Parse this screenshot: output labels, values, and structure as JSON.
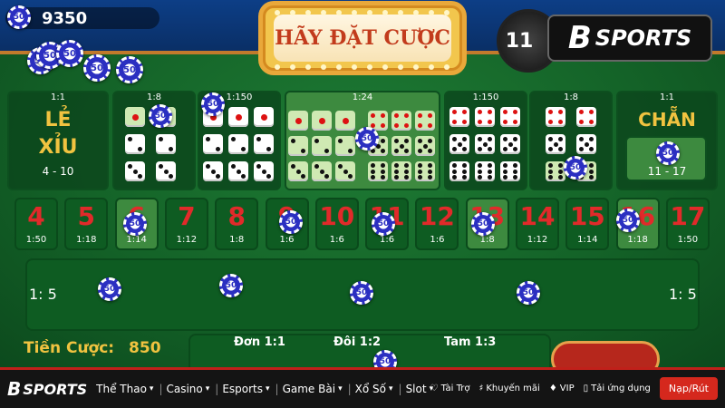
{
  "header": {
    "balance": "9350",
    "banner_text": "HÃY ĐẶT CƯỢC",
    "timer": "11",
    "brand_name": "SPORTS",
    "brand_letter": "B"
  },
  "chip_value": "50",
  "bets": {
    "le": {
      "odds": "1:1",
      "line1": "LẺ",
      "line2": "XỈU",
      "range": "4 - 10"
    },
    "chan": {
      "odds": "1:1",
      "line1": "CHẴN",
      "range": "11 - 17"
    },
    "group_odds": [
      "1:8",
      "1:150",
      "1:24",
      "1:150",
      "1:8"
    ]
  },
  "sums": [
    {
      "n": "4",
      "r": "1:50"
    },
    {
      "n": "5",
      "r": "1:18"
    },
    {
      "n": "6",
      "r": "1:14"
    },
    {
      "n": "7",
      "r": "1:12"
    },
    {
      "n": "8",
      "r": "1:8"
    },
    {
      "n": "9",
      "r": "1:6"
    },
    {
      "n": "10",
      "r": "1:6"
    },
    {
      "n": "11",
      "r": "1:6"
    },
    {
      "n": "12",
      "r": "1:6"
    },
    {
      "n": "13",
      "r": "1:8"
    },
    {
      "n": "14",
      "r": "1:12"
    },
    {
      "n": "15",
      "r": "1:14"
    },
    {
      "n": "16",
      "r": "1:18"
    },
    {
      "n": "17",
      "r": "1:50"
    }
  ],
  "combo": {
    "left_odds": "1: 5",
    "right_odds": "1: 5"
  },
  "bet_total": {
    "label": "Tiền Cược:",
    "value": "850"
  },
  "bottom": {
    "don": "Đơn 1:1",
    "doi": "Đôi 1:2",
    "tam": "Tam 1:3"
  },
  "nav": {
    "logo_letter": "B",
    "logo_text": "SPORTS",
    "items": [
      "Thể Thao",
      "Casino",
      "Esports",
      "Game Bài",
      "Xổ Số",
      "Slot"
    ],
    "right": [
      "Tài Trợ",
      "Khuyến mãi",
      "VIP",
      "Tải ứng dụng"
    ],
    "deposit": "Nạp/Rút"
  },
  "colors": {
    "felt": "#146328",
    "accent_red": "#d5281d",
    "gold": "#f1c340"
  }
}
